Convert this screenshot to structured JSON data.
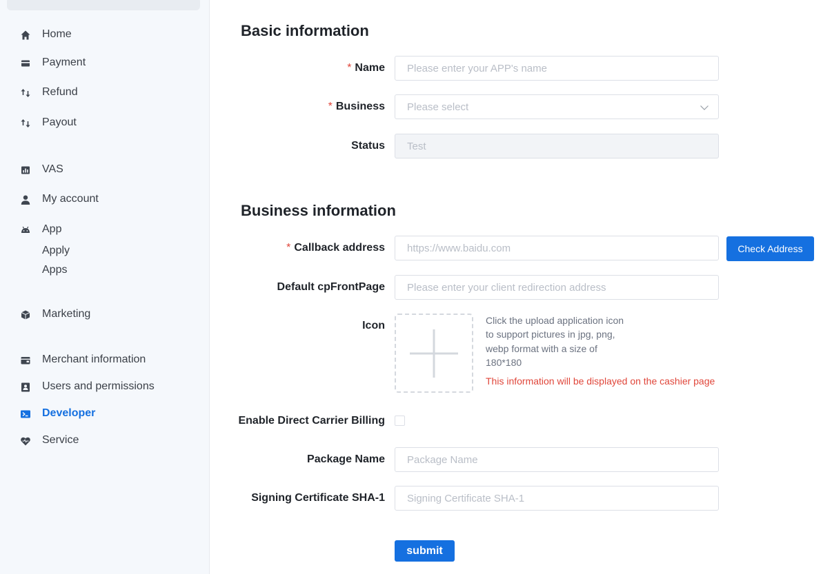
{
  "sidebar": {
    "items": [
      {
        "label": "Home",
        "icon": "home-icon"
      },
      {
        "label": "Payment",
        "icon": "card-icon"
      },
      {
        "label": "Refund",
        "icon": "swap-arrows-icon"
      },
      {
        "label": "Payout",
        "icon": "swap-arrows-icon"
      },
      {
        "label": "VAS",
        "icon": "bar-chart-icon"
      },
      {
        "label": "My account",
        "icon": "user-icon"
      },
      {
        "label": "App",
        "icon": "android-icon"
      },
      {
        "label": "Marketing",
        "icon": "box-icon"
      },
      {
        "label": "Merchant information",
        "icon": "wallet-icon"
      },
      {
        "label": "Users and permissions",
        "icon": "contacts-icon"
      },
      {
        "label": "Developer",
        "icon": "terminal-icon"
      },
      {
        "label": "Service",
        "icon": "heart-icon"
      }
    ],
    "app_sub": [
      "Apply",
      "Apps"
    ],
    "active": "Developer"
  },
  "basic": {
    "title": "Basic information",
    "name_label": "Name",
    "name_placeholder": "Please enter your APP's name",
    "business_label": "Business",
    "business_placeholder": "Please select",
    "status_label": "Status",
    "status_value": "Test"
  },
  "business": {
    "title": "Business information",
    "callback_label": "Callback address",
    "callback_placeholder": "https://www.baidu.com",
    "check_button": "Check Address",
    "front_label": "Default cpFrontPage",
    "front_placeholder": "Please enter your client redirection address",
    "icon_label": "Icon",
    "icon_hint": "Click the upload application icon to support pictures in jpg, png, webp format with a size of 180*180",
    "icon_warning": "This information will be displayed on the cashier page",
    "dcb_label": "Enable Direct Carrier Billing",
    "package_label": "Package Name",
    "package_placeholder": "Package Name",
    "sha_label": "Signing Certificate SHA-1",
    "sha_placeholder": "Signing Certificate SHA-1",
    "submit": "submit"
  },
  "colors": {
    "primary": "#1570e0",
    "required": "#e0463a",
    "sidebar_bg": "#f5f8fc"
  }
}
